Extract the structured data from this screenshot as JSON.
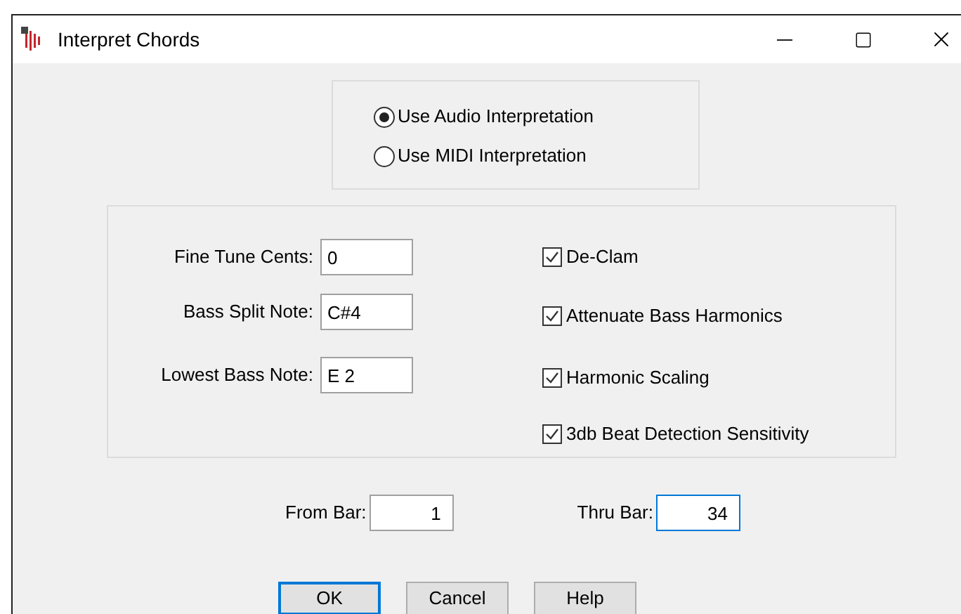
{
  "window": {
    "title": "Interpret Chords"
  },
  "interpretation": [
    {
      "label": "Use Audio Interpretation",
      "selected": true
    },
    {
      "label": "Use MIDI Interpretation",
      "selected": false
    }
  ],
  "fields": [
    {
      "label": "Fine Tune Cents:",
      "value": "0"
    },
    {
      "label": "Bass Split Note:",
      "value": "C#4"
    },
    {
      "label": "Lowest Bass Note:",
      "value": "E 2"
    }
  ],
  "options": [
    {
      "label": "De-Clam",
      "checked": true
    },
    {
      "label": "Attenuate Bass Harmonics",
      "checked": true
    },
    {
      "label": "Harmonic Scaling",
      "checked": true
    },
    {
      "label": "3db Beat Detection Sensitivity",
      "checked": true
    }
  ],
  "range": [
    {
      "label": "From Bar:",
      "value": "1",
      "focused": false
    },
    {
      "label": "Thru Bar:",
      "value": "34",
      "focused": true
    }
  ],
  "buttons": [
    {
      "label": "OK",
      "default": true
    },
    {
      "label": "Cancel",
      "default": false
    },
    {
      "label": "Help",
      "default": false
    }
  ]
}
